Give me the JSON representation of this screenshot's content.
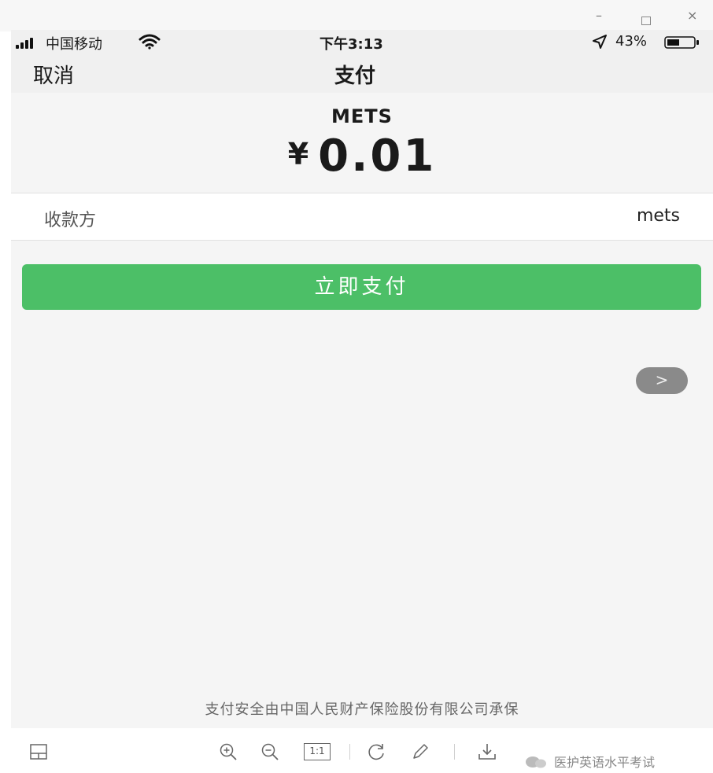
{
  "window_controls": {
    "minimize": "–",
    "close": "×"
  },
  "status_bar": {
    "carrier": "中国移动",
    "time": "下午3:13",
    "battery": "43%",
    "icons": [
      "signal-icon",
      "wifi-icon",
      "location-icon",
      "battery-icon"
    ]
  },
  "nav": {
    "cancel": "取消",
    "title": "支付"
  },
  "payment": {
    "merchant": "METS",
    "currency": "¥",
    "amount": "0.01",
    "payee_label": "收款方",
    "payee_value": "mets",
    "pay_button": "立即支付",
    "next_button": ">"
  },
  "footer": {
    "insurance_note": "支付安全由中国人民财产保险股份有限公司承保"
  },
  "viewer_toolbar": {
    "icons": [
      "thumbnail-icon",
      "zoom-in-icon",
      "zoom-out-icon",
      "actual-size-icon",
      "rotate-icon",
      "edit-icon",
      "download-icon"
    ],
    "actual_size_label": "1:1",
    "watermark": "医护英语水平考试"
  },
  "colors": {
    "primary_green": "#4cbf67",
    "background": "#f5f5f5"
  }
}
